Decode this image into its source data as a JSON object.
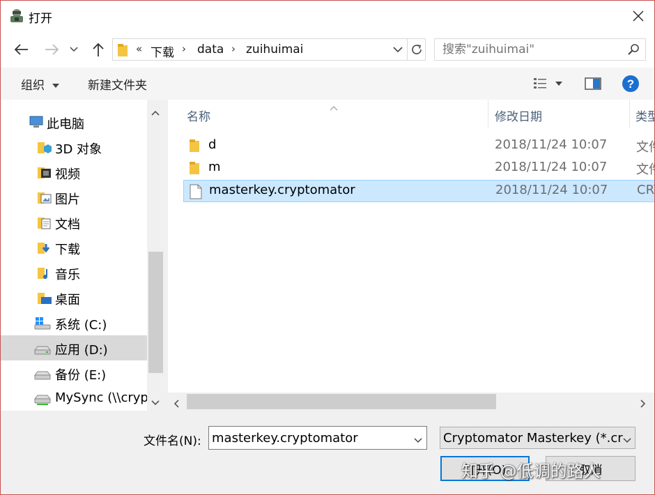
{
  "window": {
    "title": "打开"
  },
  "address": {
    "overflow": "«",
    "crumbs": [
      "下载",
      "data",
      "zuihuimai"
    ]
  },
  "search": {
    "placeholder": "搜索\"zuihuimai\""
  },
  "toolbar": {
    "organize": "组织",
    "new_folder": "新建文件夹"
  },
  "sidebar": {
    "items": [
      {
        "label": "此电脑",
        "icon": "computer-icon"
      },
      {
        "label": "3D 对象",
        "icon": "3d-objects-icon"
      },
      {
        "label": "视频",
        "icon": "videos-icon"
      },
      {
        "label": "图片",
        "icon": "pictures-icon"
      },
      {
        "label": "文档",
        "icon": "documents-icon"
      },
      {
        "label": "下载",
        "icon": "downloads-icon"
      },
      {
        "label": "音乐",
        "icon": "music-icon"
      },
      {
        "label": "桌面",
        "icon": "desktop-icon"
      },
      {
        "label": "系统 (C:)",
        "icon": "windows-drive-icon"
      },
      {
        "label": "应用 (D:)",
        "icon": "drive-icon",
        "selected": true
      },
      {
        "label": "备份 (E:)",
        "icon": "drive-icon"
      },
      {
        "label": "MySync (\\\\cryp",
        "icon": "network-drive-icon"
      }
    ]
  },
  "columns": {
    "name": "名称",
    "modified": "修改日期",
    "type": "类型"
  },
  "files": [
    {
      "name": "d",
      "modified": "2018/11/24 10:07",
      "type": "文件",
      "icon": "folder-icon"
    },
    {
      "name": "m",
      "modified": "2018/11/24 10:07",
      "type": "文件",
      "icon": "folder-icon"
    },
    {
      "name": "masterkey.cryptomator",
      "modified": "2018/11/24 10:07",
      "type": "CRY",
      "icon": "file-icon",
      "selected": true
    }
  ],
  "footer": {
    "filename_label": "文件名(N):",
    "filename_value": "masterkey.cryptomator",
    "filetype_value": "Cryptomator Masterkey (*.cry",
    "open_label": "打开(O)",
    "cancel_label": "取消"
  },
  "watermark": "知乎 @低调的路人",
  "colors": {
    "selection": "#cce8ff",
    "selection_border": "#99d1ff",
    "accent": "#0078d7"
  }
}
